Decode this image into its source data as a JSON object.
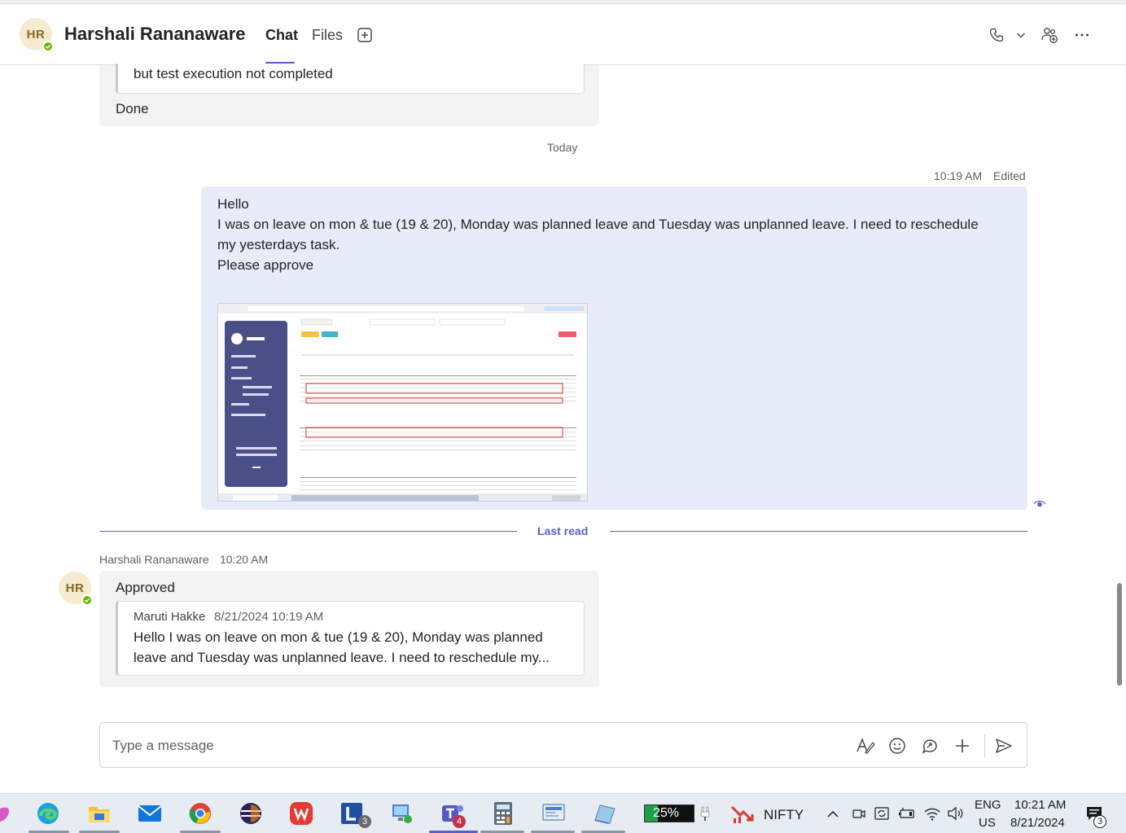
{
  "header": {
    "avatar_initials": "HR",
    "contact_name": "Harshali Rananaware",
    "tabs": [
      {
        "label": "Chat",
        "active": true
      },
      {
        "label": "Files",
        "active": false
      }
    ],
    "accent_color": "#5b5fc7",
    "presence_color": "#6bb700"
  },
  "messages": {
    "earlier": {
      "quote_line": "but test execution not completed",
      "text": "Done"
    },
    "day_divider": "Today",
    "outgoing": {
      "time": "10:19 AM",
      "edited_label": "Edited",
      "lines": [
        "Hello",
        "I was on leave on mon & tue (19 & 20), Monday was planned leave and Tuesday was unplanned leave. I need to reschedule",
        "my yesterdays task.",
        "Please approve"
      ],
      "attachment_icon": "screenshot-thumbnail",
      "read_receipt_icon": "eye-icon"
    },
    "last_read_label": "Last read",
    "reply": {
      "sender": "Harshali Rananaware",
      "time": "10:20 AM",
      "avatar_initials": "HR",
      "text": "Approved",
      "quote": {
        "sender": "Maruti Hakke",
        "timestamp": "8/21/2024 10:19 AM",
        "line1": "Hello I was on leave on mon & tue (19 & 20), Monday was planned",
        "line2": "leave and Tuesday was unplanned leave. I need to reschedule my..."
      }
    }
  },
  "compose": {
    "placeholder": "Type a message"
  },
  "taskbar": {
    "battery": "25%",
    "ticker": "NIFTY",
    "lang_line1": "ENG",
    "lang_line2": "US",
    "time": "10:21 AM",
    "date": "8/21/2024",
    "l_badge": "3",
    "teams_badge": "4",
    "notif_badge": "3"
  }
}
